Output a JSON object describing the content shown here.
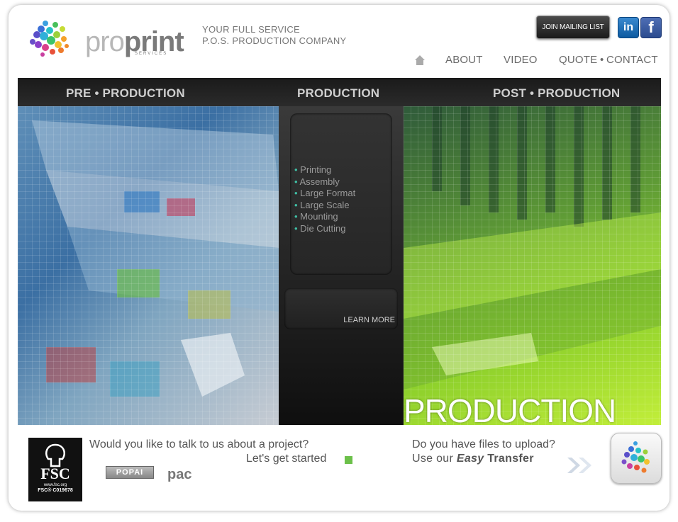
{
  "header": {
    "logo_pro": "pro",
    "logo_print": "print",
    "logo_sub": "SERVICES",
    "tagline_1": "YOUR FULL SERVICE",
    "tagline_2": "P.O.S. PRODUCTION COMPANY",
    "mailing_label": "JOIN MAILING LIST",
    "linkedin_glyph": "in",
    "facebook_glyph": "f"
  },
  "nav": {
    "home_icon": "home-icon",
    "items": [
      "ABOUT",
      "VIDEO",
      "QUOTE",
      "CONTACT"
    ],
    "separator": "•"
  },
  "strip": {
    "tab_pre": "PRE • PRODUCTION",
    "tab_production": "PRODUCTION",
    "tab_post": "POST • PRODUCTION"
  },
  "production_panel": {
    "services": [
      "Printing",
      "Assembly",
      "Large Format",
      "Large Scale",
      "Mounting",
      "Die Cutting"
    ],
    "learn_more": "LEARN MORE",
    "hero_word": "PRODUCTION"
  },
  "footer": {
    "fsc_mark": "FSC",
    "fsc_url": "www.fsc.org",
    "fsc_code": "FSC® C019678",
    "project_question": "Would you like to talk to us about a project?",
    "project_cta": "Let's get started",
    "popai": "POPAI",
    "pac": "pac",
    "upload_question": "Do you have files to upload?",
    "upload_prefix": "Use our",
    "upload_easy": "Easy",
    "upload_transfer": "Transfer"
  },
  "colors": {
    "accent_green": "#6cc04a",
    "bullet_teal": "#3fbfa5"
  }
}
